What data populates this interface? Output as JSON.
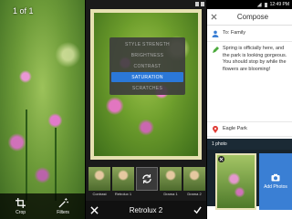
{
  "viewer": {
    "counter": "1 of 1",
    "tools": [
      {
        "label": "Crop",
        "icon": "crop-icon"
      },
      {
        "label": "Filters",
        "icon": "magic-wand-icon"
      }
    ]
  },
  "editor": {
    "adjust_menu": [
      "STYLE STRENGTH",
      "BRIGHTNESS",
      "CONTRAST",
      "SATURATION",
      "SCRATCHES"
    ],
    "selected_adjustment": "SATURATION",
    "filters": [
      {
        "name": "Contrast"
      },
      {
        "name": "Retrolux 1"
      },
      {
        "name": ""
      },
      {
        "name": "Drama 1"
      },
      {
        "name": "Drama 2"
      }
    ],
    "title": "Retrolux 2"
  },
  "compose": {
    "status_time": "12:49 PM",
    "title": "Compose",
    "to": "To: Family",
    "message": "Spring is officially here, and the park is looking gorgeous. You should stop by while the flowers are blooming!",
    "location": "Eagle Park",
    "photos_label": "1 photo",
    "add_photos_label": "Add Photos",
    "accent": "#3a7fd4"
  }
}
